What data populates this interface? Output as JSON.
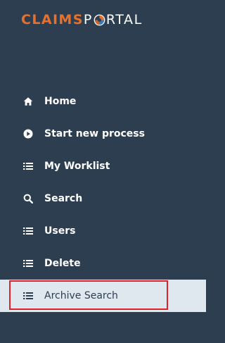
{
  "logo": {
    "part_claims": "CLAIMS",
    "part_p": "P",
    "part_rtal": "RTAL"
  },
  "nav": {
    "items": [
      {
        "label": "Home",
        "icon": "home-icon"
      },
      {
        "label": "Start new process",
        "icon": "play-circle-icon"
      },
      {
        "label": "My Worklist",
        "icon": "list-icon"
      },
      {
        "label": "Search",
        "icon": "search-icon"
      },
      {
        "label": "Users",
        "icon": "list-icon"
      },
      {
        "label": "Delete",
        "icon": "list-icon"
      },
      {
        "label": "Archive Search",
        "icon": "list-icon",
        "active": true
      }
    ]
  },
  "colors": {
    "sidebar_bg": "#2d3e50",
    "active_bg": "#dfe7ef",
    "brand_orange": "#e9702a",
    "highlight_red": "#e0212b"
  }
}
